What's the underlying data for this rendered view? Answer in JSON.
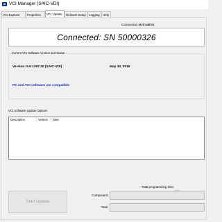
{
  "window": {
    "title": "VCI Manager (SAIC-VDI)"
  },
  "tabs": [
    {
      "label": "VCI Explorer",
      "active": false
    },
    {
      "label": "Properties",
      "active": false
    },
    {
      "label": "VCI Update",
      "active": true
    },
    {
      "label": "Network Setup",
      "active": false
    },
    {
      "label": "Logging",
      "active": false
    },
    {
      "label": "Help",
      "active": false
    }
  ],
  "connection": {
    "method_label": "Connection Method:",
    "method_value": "USB",
    "status_text": "Connected:  SN 50000326"
  },
  "software_status": {
    "group_title": "Current VCI Software Version and Status",
    "version": "Version: 9.0.1397.30 [SAIC-VDI]",
    "date": "May 30, 2019",
    "compatibility": "PC and VCI software are compatible"
  },
  "update_options": {
    "label": "VCI Software Update Options",
    "columns": [
      "Description",
      "Version",
      "Date"
    ]
  },
  "programming": {
    "total_time_label": "Total programming time:",
    "total_time_value": "",
    "component_label": "Component",
    "total_label": "Total",
    "component_progress": 0,
    "total_progress": 0,
    "start_button": "Start Update"
  },
  "colors": {
    "compatible_text": "#1a2fc4",
    "progress_fill": "#06b025"
  }
}
